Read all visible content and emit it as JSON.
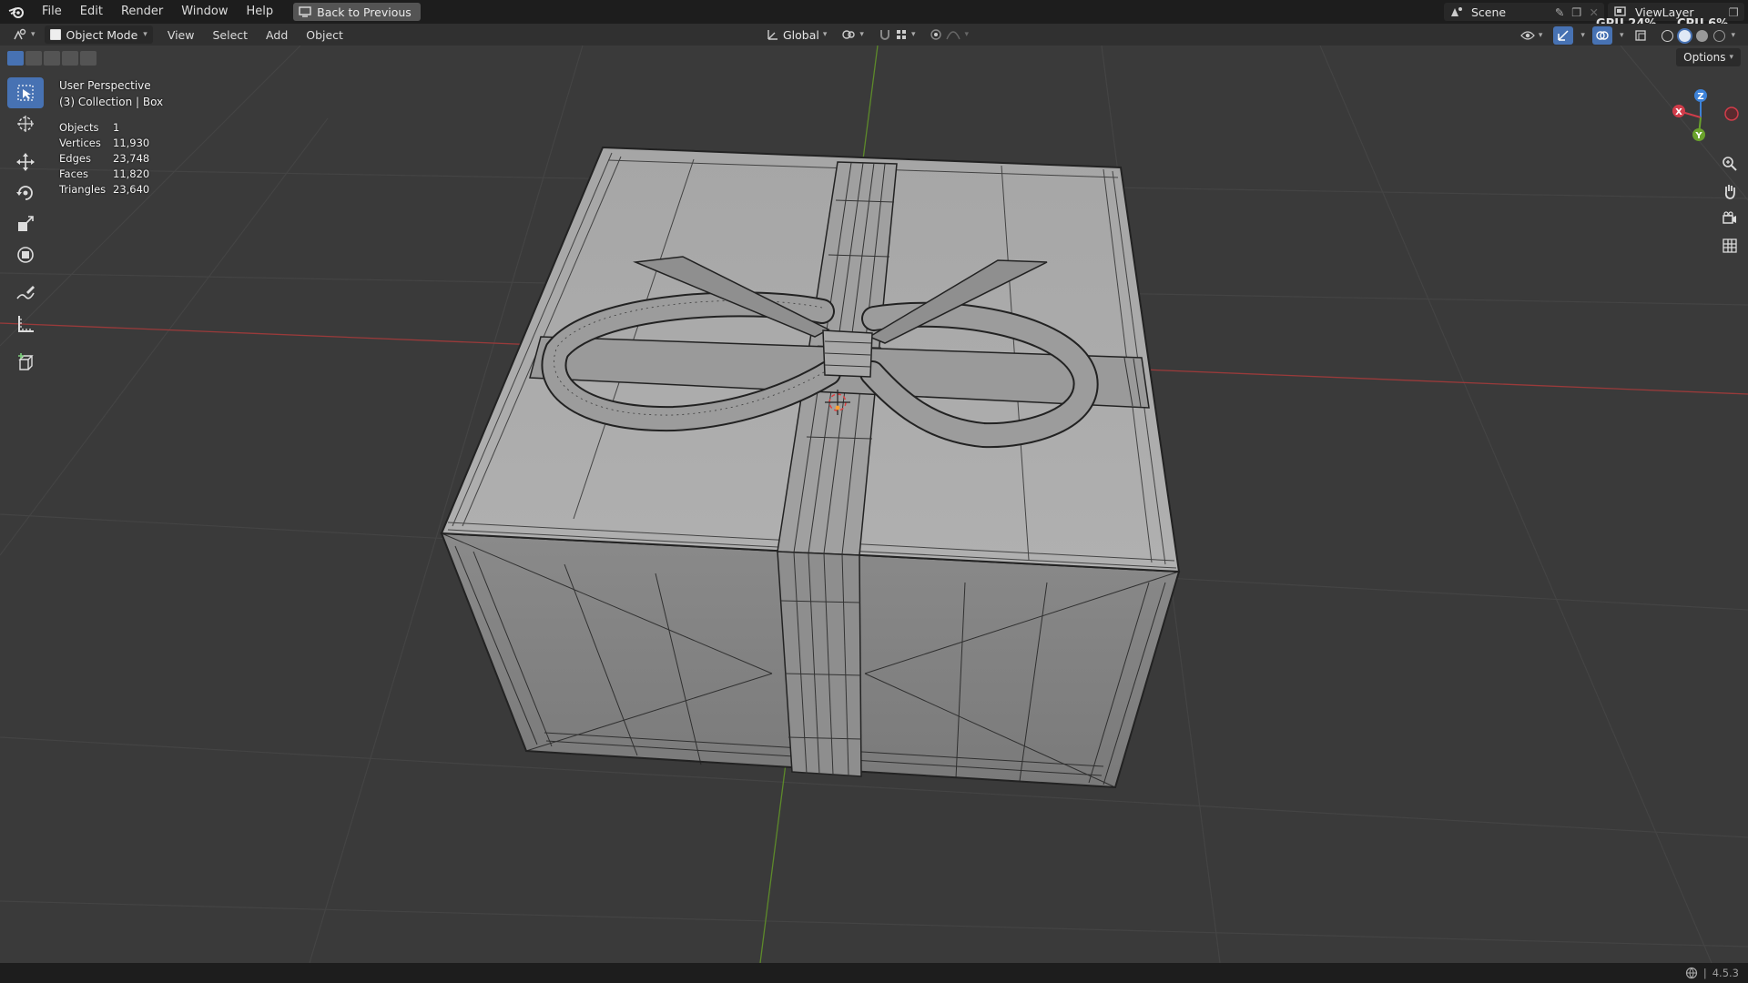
{
  "menu": {
    "items": [
      "File",
      "Edit",
      "Render",
      "Window",
      "Help"
    ],
    "back_button": "Back to Previous"
  },
  "topright": {
    "scene": "Scene",
    "view_layer": "ViewLayer",
    "gpu_label": "GPU",
    "gpu_value": "24%",
    "cpu_label": "CPU",
    "cpu_value": "6%"
  },
  "header": {
    "mode": "Object Mode",
    "menus": [
      "View",
      "Select",
      "Add",
      "Object"
    ],
    "transform_orientation": "Global",
    "options_label": "Options"
  },
  "overlay": {
    "perspective": "User Perspective",
    "collection": "(3) Collection | Box"
  },
  "stats": [
    {
      "label": "Objects",
      "value": "1"
    },
    {
      "label": "Vertices",
      "value": "11,930"
    },
    {
      "label": "Edges",
      "value": "23,748"
    },
    {
      "label": "Faces",
      "value": "11,820"
    },
    {
      "label": "Triangles",
      "value": "23,640"
    }
  ],
  "gizmo": {
    "z": "Z",
    "x": "X",
    "y": "Y"
  },
  "status": {
    "version": "4.5.3"
  },
  "colors": {
    "accent": "#4772b3",
    "x_axis": "#d13c4a",
    "y_axis": "#6aa22c",
    "z_axis": "#3d82d8"
  },
  "tools": [
    "select-box",
    "cursor",
    "move",
    "rotate",
    "scale",
    "transform",
    "annotate",
    "measure",
    "add-cube"
  ]
}
